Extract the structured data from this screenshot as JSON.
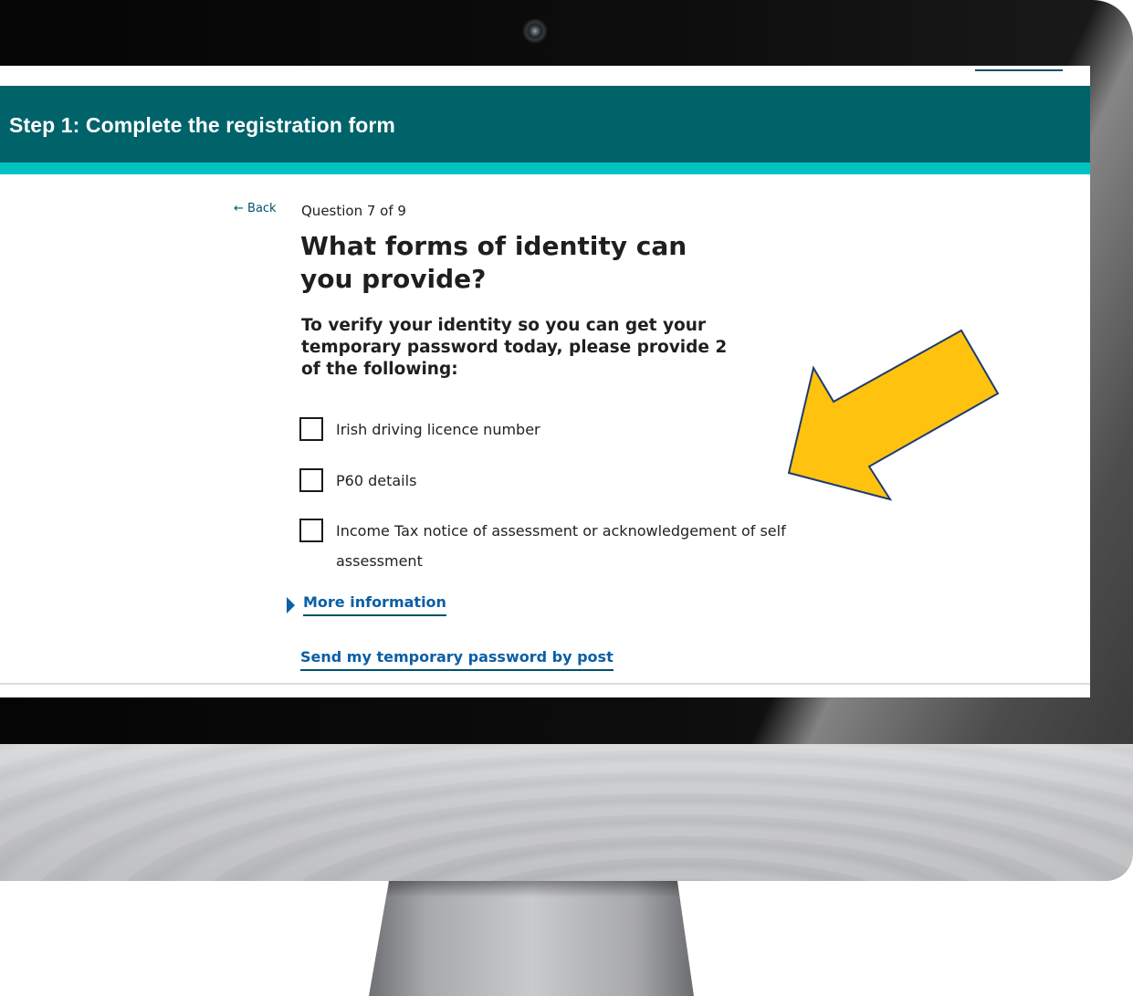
{
  "banner": {
    "title": "Step 1: Complete the registration form"
  },
  "nav": {
    "back_label": "← Back"
  },
  "question": {
    "counter": "Question 7 of 9",
    "heading": "What forms of identity can you provide?",
    "lead": "To verify your identity so you can get your temporary password today, please provide 2 of the following:"
  },
  "options": [
    {
      "label": "Irish driving licence number",
      "checked": false
    },
    {
      "label": "P60 details",
      "checked": false
    },
    {
      "label": "Income Tax notice of assessment or acknowledgement of self assessment",
      "checked": false
    }
  ],
  "more_info": {
    "label": "More information"
  },
  "post_link": {
    "label": "Send my temporary password by post"
  },
  "colors": {
    "banner": "#00636a",
    "banner_stripe": "#00c4c3",
    "link": "#0b5fa5",
    "arrow_fill": "#ffc20e",
    "arrow_stroke": "#1f3b73"
  }
}
